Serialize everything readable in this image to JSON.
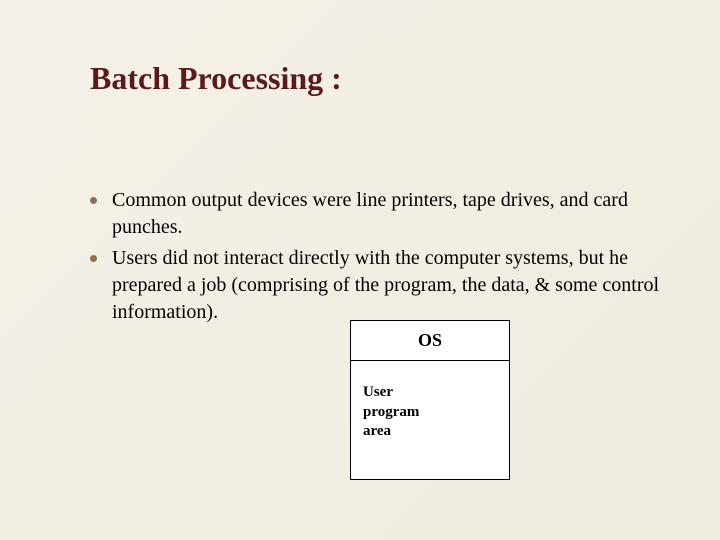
{
  "title": "Batch Processing :",
  "bullets": [
    "Common output devices were line printers, tape drives, and card punches.",
    "Users did not interact directly with the computer systems, but he prepared a job (comprising of the program, the data, & some control information)."
  ],
  "diagram": {
    "top_label": "OS",
    "bottom_label_line1": "User",
    "bottom_label_line2": "program",
    "bottom_label_line3": "area"
  }
}
